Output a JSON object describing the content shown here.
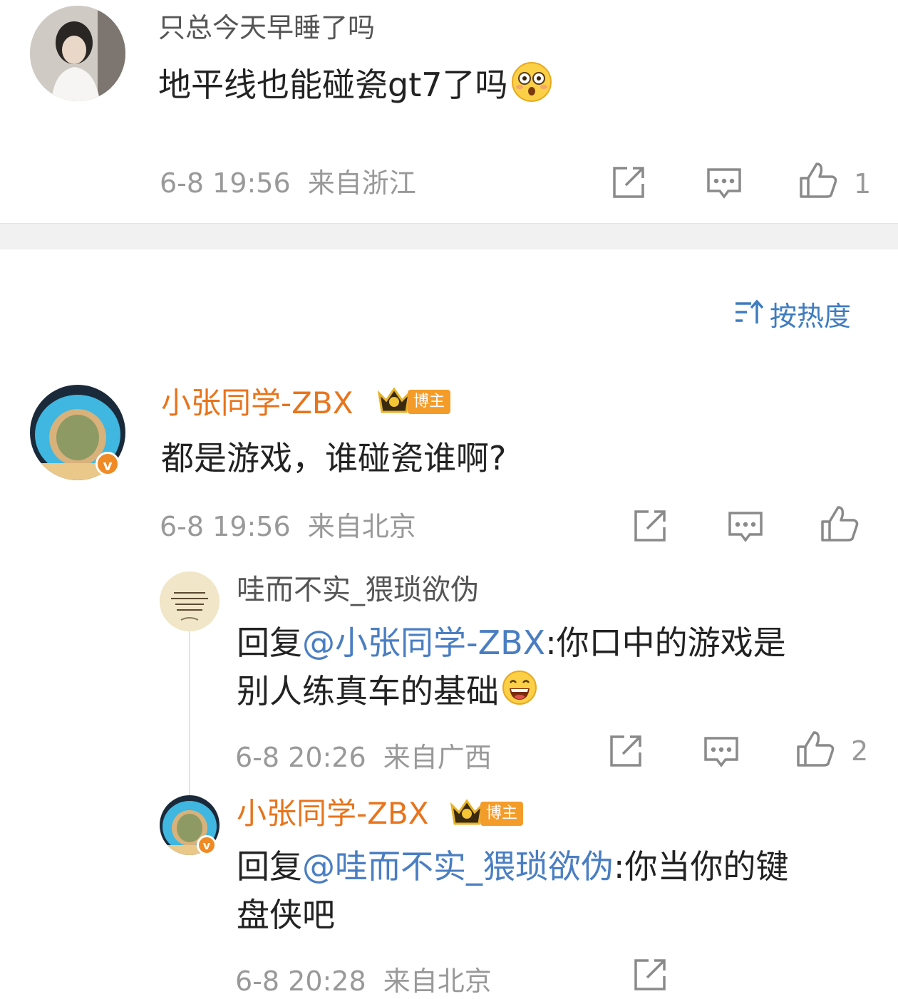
{
  "comment1": {
    "username": "只总今天早睡了吗",
    "text": "地平线也能碰瓷gt7了吗",
    "emoji": "flushed-face-icon",
    "time": "6-8 19:56",
    "location": "来自浙江",
    "like_count": "1"
  },
  "sort": {
    "label": "按热度",
    "icon": "sort-icon"
  },
  "comment2": {
    "username": "小张同学-ZBX",
    "host_badge": "博主",
    "verified": "v",
    "text": "都是游戏，谁碰瓷谁啊?",
    "time": "6-8 19:56",
    "location": "来自北京",
    "like_count": ""
  },
  "reply1": {
    "username": "哇而不实_猥琐欲伪",
    "prefix": "回复",
    "mention": "@小张同学-ZBX",
    "text_line1": ":你口中的游戏是",
    "text_line2": "别人练真车的基础",
    "emoji": "grinning-face-icon",
    "time": "6-8 20:26",
    "location": "来自广西",
    "like_count": "2"
  },
  "reply2": {
    "username": "小张同学-ZBX",
    "host_badge": "博主",
    "verified": "v",
    "prefix": "回复",
    "mention": "@哇而不实_猥琐欲伪",
    "text_line1": ":你当你的键",
    "text_line2": "盘侠吧",
    "time": "6-8 20:28",
    "location": "来自北京"
  },
  "colors": {
    "orange_name": "#e8741c",
    "link_blue": "#4a7ec2",
    "meta_gray": "#999999",
    "divider": "#f1f1f1"
  }
}
